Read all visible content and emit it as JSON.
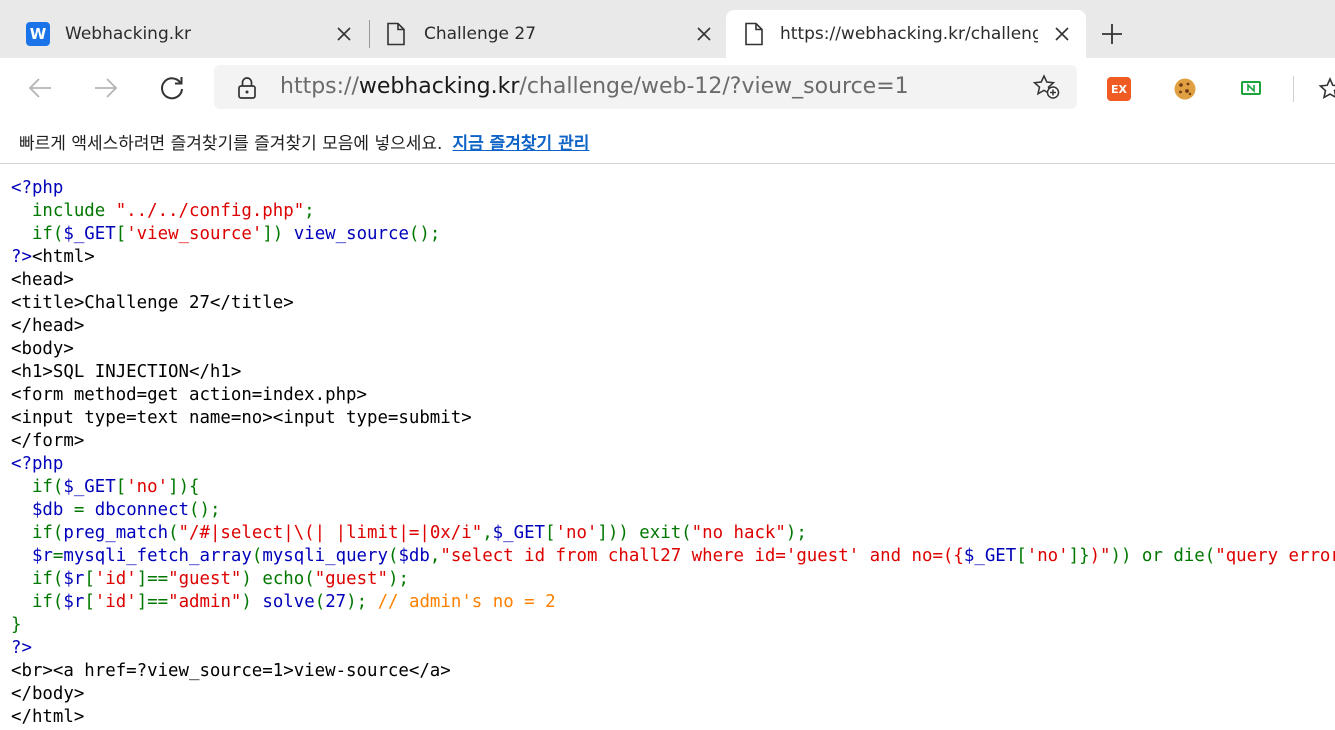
{
  "tabs": [
    {
      "title": "Webhacking.kr",
      "favicon": "W"
    },
    {
      "title": "Challenge 27"
    },
    {
      "title": "https://webhacking.kr/challenge/"
    }
  ],
  "address": {
    "scheme": "https://",
    "host": "webhacking.kr",
    "path": "/challenge/web-12/?view_source=1"
  },
  "extensions": {
    "ex_label": "EX"
  },
  "favorites_bar": {
    "message": "빠르게 액세스하려면 즐겨찾기를 즐겨찾기 모음에 넣으세요.",
    "link": "지금 즐겨찾기 관리"
  },
  "source": [
    [
      [
        "b",
        "<?php"
      ]
    ],
    [
      [
        "g",
        "  include "
      ],
      [
        "r",
        "\"../../config.php\""
      ],
      [
        "g",
        ";"
      ]
    ],
    [
      [
        "g",
        "  if("
      ],
      [
        "b",
        "$_GET"
      ],
      [
        "g",
        "["
      ],
      [
        "r",
        "'view_source'"
      ],
      [
        "g",
        "]) "
      ],
      [
        "b",
        "view_source"
      ],
      [
        "g",
        "();"
      ]
    ],
    [
      [
        "b",
        "?>"
      ],
      [
        "k",
        "<html>"
      ]
    ],
    [
      [
        "k",
        "<head>"
      ]
    ],
    [
      [
        "k",
        "<title>Challenge 27</title>"
      ]
    ],
    [
      [
        "k",
        "</head>"
      ]
    ],
    [
      [
        "k",
        "<body>"
      ]
    ],
    [
      [
        "k",
        "<h1>SQL INJECTION</h1>"
      ]
    ],
    [
      [
        "k",
        "<form method=get action=index.php>"
      ]
    ],
    [
      [
        "k",
        "<input type=text name=no><input type=submit>"
      ]
    ],
    [
      [
        "k",
        "</form>"
      ]
    ],
    [
      [
        "b",
        "<?php"
      ]
    ],
    [
      [
        "g",
        "  if("
      ],
      [
        "b",
        "$_GET"
      ],
      [
        "g",
        "["
      ],
      [
        "r",
        "'no'"
      ],
      [
        "g",
        "]){"
      ]
    ],
    [
      [
        "b",
        "  $db "
      ],
      [
        "g",
        "= "
      ],
      [
        "b",
        "dbconnect"
      ],
      [
        "g",
        "();"
      ]
    ],
    [
      [
        "g",
        "  if("
      ],
      [
        "b",
        "preg_match"
      ],
      [
        "g",
        "("
      ],
      [
        "r",
        "\"/#|select|\\(| |limit|=|0x/i\""
      ],
      [
        "g",
        ","
      ],
      [
        "b",
        "$_GET"
      ],
      [
        "g",
        "["
      ],
      [
        "r",
        "'no'"
      ],
      [
        "g",
        "])) exit("
      ],
      [
        "r",
        "\"no hack\""
      ],
      [
        "g",
        ");"
      ]
    ],
    [
      [
        "b",
        "  $r"
      ],
      [
        "g",
        "="
      ],
      [
        "b",
        "mysqli_fetch_array"
      ],
      [
        "g",
        "("
      ],
      [
        "b",
        "mysqli_query"
      ],
      [
        "g",
        "("
      ],
      [
        "b",
        "$db"
      ],
      [
        "g",
        ","
      ],
      [
        "r",
        "\"select id from chall27 where id='guest' and no=({"
      ],
      [
        "b",
        "$_GET"
      ],
      [
        "g",
        "["
      ],
      [
        "r",
        "'no'"
      ],
      [
        "g",
        "]}"
      ],
      [
        "r",
        ")\""
      ],
      [
        "g",
        ")) or die("
      ],
      [
        "r",
        "\"query error\""
      ],
      [
        "g",
        ");"
      ]
    ],
    [
      [
        "g",
        "  if("
      ],
      [
        "b",
        "$r"
      ],
      [
        "g",
        "["
      ],
      [
        "r",
        "'id'"
      ],
      [
        "g",
        "]=="
      ],
      [
        "r",
        "\"guest\""
      ],
      [
        "g",
        ") echo("
      ],
      [
        "r",
        "\"guest\""
      ],
      [
        "g",
        ");"
      ]
    ],
    [
      [
        "g",
        "  if("
      ],
      [
        "b",
        "$r"
      ],
      [
        "g",
        "["
      ],
      [
        "r",
        "'id'"
      ],
      [
        "g",
        "]=="
      ],
      [
        "r",
        "\"admin\""
      ],
      [
        "g",
        ") "
      ],
      [
        "b",
        "solve"
      ],
      [
        "g",
        "("
      ],
      [
        "b",
        "27"
      ],
      [
        "g",
        "); "
      ],
      [
        "o",
        "// admin's no = 2"
      ]
    ],
    [
      [
        "g",
        "}"
      ]
    ],
    [
      [
        "b",
        "?>"
      ]
    ],
    [
      [
        "k",
        "<br><a href=?view_source=1>view-source</a>"
      ]
    ],
    [
      [
        "k",
        "</body>"
      ]
    ],
    [
      [
        "k",
        "</html>"
      ]
    ]
  ]
}
